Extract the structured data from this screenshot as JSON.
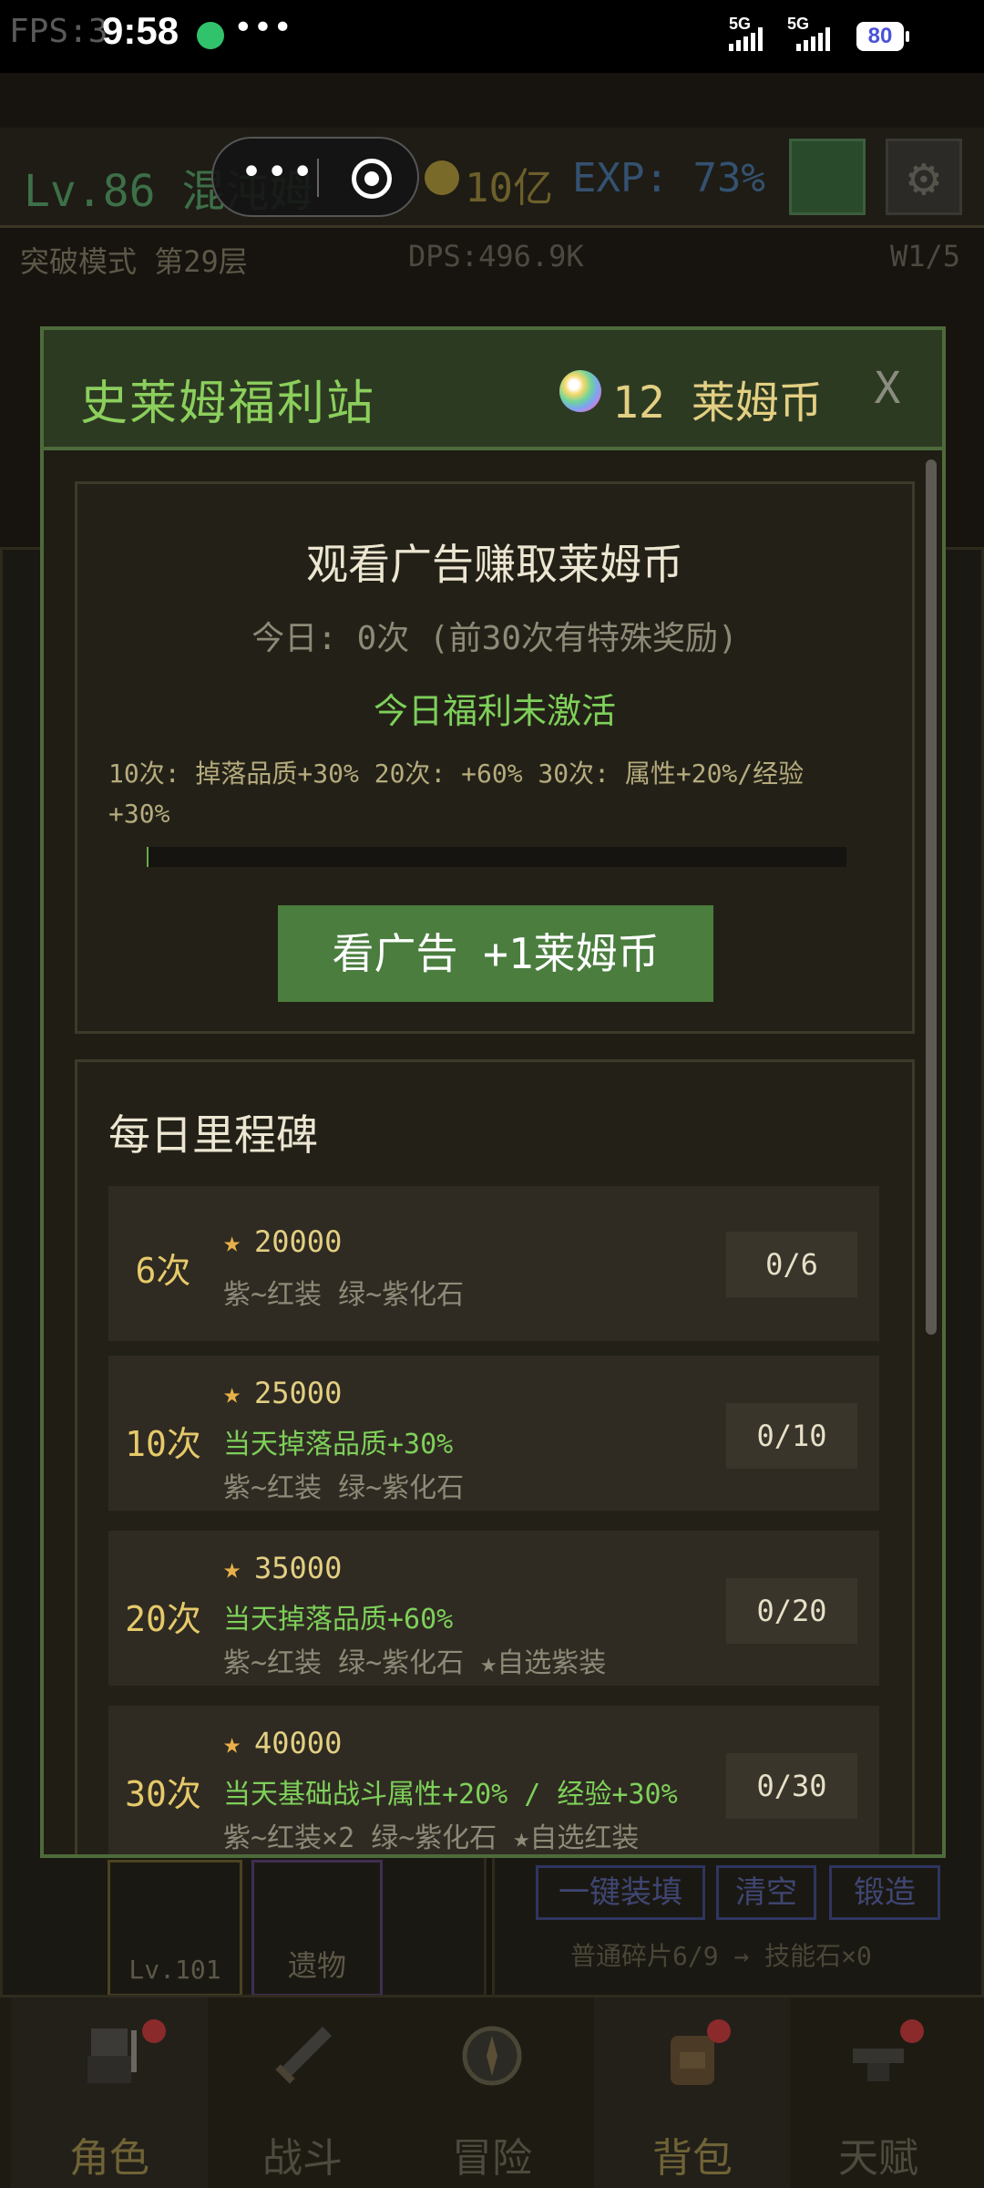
{
  "statusbar": {
    "fps": "FPS:3",
    "time": "9:58",
    "more": "•••",
    "net1": "5G",
    "net2": "5G",
    "battery": "80"
  },
  "hud": {
    "level": "Lv.86 混沌姆",
    "gold": "10亿",
    "exp": "EXP: 73%",
    "stage": "突破模式 第29层",
    "dps": "DPS:496.9K",
    "wave": "W1/5"
  },
  "under": {
    "level_label": "Lv.101",
    "relic_label": "遗物",
    "btn_load": "一键装填",
    "btn_clear": "清空",
    "btn_forge": "锻造",
    "shard_text": "普通碎片6/9 → 技能石×0"
  },
  "nav": {
    "items": [
      {
        "label": "角色",
        "icon": "knight-icon"
      },
      {
        "label": "战斗",
        "icon": "sword-icon"
      },
      {
        "label": "冒险",
        "icon": "compass-icon"
      },
      {
        "label": "背包",
        "icon": "backpack-icon"
      },
      {
        "label": "天赋",
        "icon": "anvil-icon"
      }
    ]
  },
  "modal": {
    "title": "史莱姆福利站",
    "coin_count": "12",
    "coin_label": "莱姆币",
    "close": "X",
    "ad": {
      "title": "观看广告赚取莱姆币",
      "today": "今日: 0次 (前30次有特殊奖励)",
      "status": "今日福利未激活",
      "rewards": "10次: 掉落品质+30%  20次: +60%  30次: 属性+20%/经验+30%",
      "progress": 0,
      "button": "看广告 +1莱姆币"
    },
    "milestones": {
      "title": "每日里程碑",
      "rows": [
        {
          "count": "6次",
          "amount": "20000",
          "green": "",
          "gray": "紫~红装 绿~紫化石",
          "progress": "0/6"
        },
        {
          "count": "10次",
          "amount": "25000",
          "green": "当天掉落品质+30%",
          "gray": "紫~红装 绿~紫化石",
          "progress": "0/10"
        },
        {
          "count": "20次",
          "amount": "35000",
          "green": "当天掉落品质+60%",
          "gray": "紫~红装 绿~紫化石 ★自选紫装",
          "progress": "0/20"
        },
        {
          "count": "30次",
          "amount": "40000",
          "green": "当天基础战斗属性+20% / 经验+30%",
          "gray": "紫~红装×2 绿~紫化石 ★自选红装",
          "progress": "0/30"
        }
      ]
    }
  },
  "colors": {
    "accent_green": "#7ed05a",
    "gold_text": "#e3cf83",
    "button_green": "#4a7d3e",
    "modal_border": "#4d6b3a"
  }
}
